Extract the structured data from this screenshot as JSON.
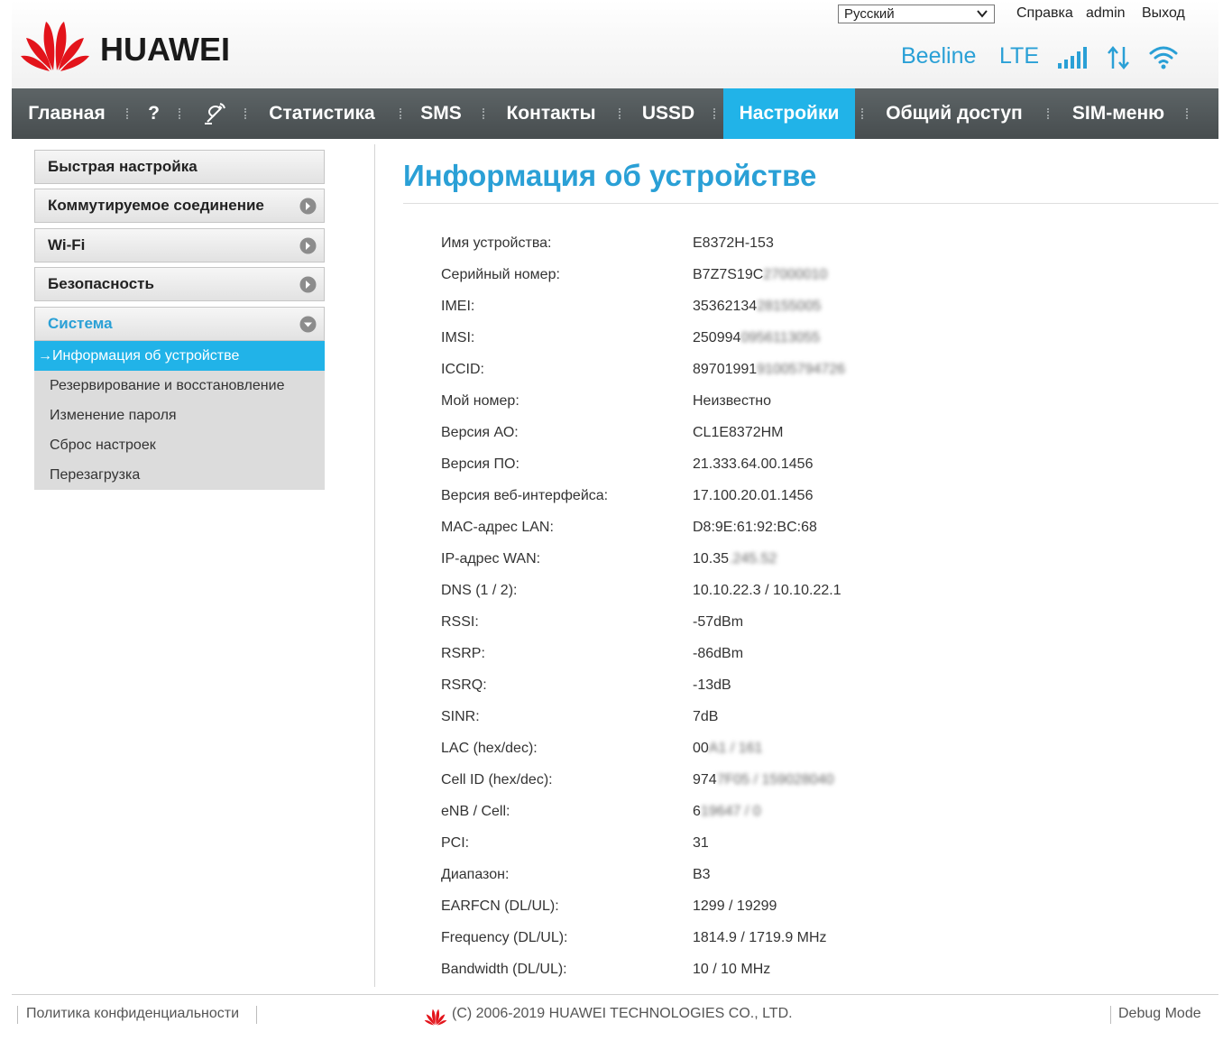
{
  "header": {
    "brand": "HUAWEI",
    "language": "Русский",
    "help": "Справка",
    "user": "admin",
    "logout": "Выход",
    "operator": "Beeline",
    "network": "LTE"
  },
  "nav": {
    "home": "Главная",
    "help": "?",
    "stats": "Статистика",
    "sms": "SMS",
    "contacts": "Контакты",
    "ussd": "USSD",
    "settings": "Настройки",
    "sharing": "Общий доступ",
    "sim": "SIM-меню"
  },
  "sidebar": {
    "quick": "Быстрая настройка",
    "dialup": "Коммутируемое соединение",
    "wifi": "Wi-Fi",
    "security": "Безопасность",
    "system": "Система",
    "sub": [
      "Информация об устройстве",
      "Резервирование и восстановление",
      "Изменение пароля",
      "Сброс настроек",
      "Перезагрузка"
    ]
  },
  "main": {
    "title": "Информация об устройстве",
    "rows": [
      {
        "label": "Имя устройства:",
        "value": "E8372H-153",
        "hidden": ""
      },
      {
        "label": "Серийный номер:",
        "value": "B7Z7S19C",
        "hidden": "27000010"
      },
      {
        "label": "IMEI:",
        "value": "35362134",
        "hidden": "28155005"
      },
      {
        "label": "IMSI:",
        "value": "250994",
        "hidden": "0956113055"
      },
      {
        "label": "ICCID:",
        "value": "89701991",
        "hidden": "91005794726"
      },
      {
        "label": "Мой номер:",
        "value": "Неизвестно",
        "hidden": ""
      },
      {
        "label": "Версия АО:",
        "value": "CL1E8372HM",
        "hidden": ""
      },
      {
        "label": "Версия ПО:",
        "value": "21.333.64.00.1456",
        "hidden": ""
      },
      {
        "label": "Версия веб-интерфейса:",
        "value": "17.100.20.01.1456",
        "hidden": ""
      },
      {
        "label": "MAC-адрес LAN:",
        "value": "D8:9E:61:92:BC:68",
        "hidden": ""
      },
      {
        "label": "IP-адрес WAN:",
        "value": "10.35",
        "hidden": ".245.52"
      },
      {
        "label": "DNS (1 / 2):",
        "value": "10.10.22.3 / 10.10.22.1",
        "hidden": ""
      },
      {
        "label": "RSSI:",
        "value": "-57dBm",
        "hidden": ""
      },
      {
        "label": "RSRP:",
        "value": "-86dBm",
        "hidden": ""
      },
      {
        "label": "RSRQ:",
        "value": "-13dB",
        "hidden": ""
      },
      {
        "label": "SINR:",
        "value": "7dB",
        "hidden": ""
      },
      {
        "label": "LAC (hex/dec):",
        "value": "00",
        "hidden": "A1 / 161"
      },
      {
        "label": "Cell ID (hex/dec):",
        "value": "974",
        "hidden": "7F05 / 159028040"
      },
      {
        "label": "eNB / Cell:",
        "value": "6",
        "hidden": "19647 / 0"
      },
      {
        "label": "PCI:",
        "value": "31",
        "hidden": ""
      },
      {
        "label": "Диапазон:",
        "value": "B3",
        "hidden": ""
      },
      {
        "label": "EARFCN (DL/UL):",
        "value": "1299 / 19299",
        "hidden": ""
      },
      {
        "label": "Frequency (DL/UL):",
        "value": "1814.9 / 1719.9 MHz",
        "hidden": ""
      },
      {
        "label": "Bandwidth (DL/UL):",
        "value": "10 / 10 MHz",
        "hidden": ""
      }
    ]
  },
  "footer": {
    "privacy": "Политика конфиденциальности",
    "copyright": "(C) 2006-2019 HUAWEI TECHNOLOGIES CO., LTD.",
    "debug": "Debug Mode"
  },
  "colors": {
    "accent": "#21b3e8",
    "title": "#2aa0d6",
    "nav": "#4f5658"
  }
}
